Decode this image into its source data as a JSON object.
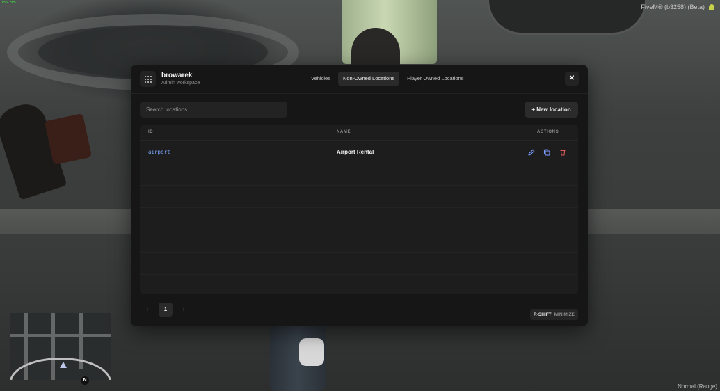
{
  "hud": {
    "fps": "156 FPS",
    "fivem_label": "FiveM® (b3258) (Beta)",
    "mode_label": "Normal (Range)",
    "compass": "N"
  },
  "panel": {
    "icon": "grid-dots-icon",
    "title": "browarek",
    "subtitle": "Admin workspace",
    "tabs": [
      {
        "label": "Vehicles",
        "active": false
      },
      {
        "label": "Non-Owned Locations",
        "active": true
      },
      {
        "label": "Player Owned Locations",
        "active": false
      }
    ],
    "close_icon": "close-icon",
    "close_glyph": "✕"
  },
  "toolbar": {
    "search_placeholder": "Search locations...",
    "new_button_label": "+ New location"
  },
  "table": {
    "columns": [
      "ID",
      "NAME",
      "ACTIONS"
    ],
    "rows": [
      {
        "id": "airport",
        "name": "Airport Rental",
        "actions": [
          "edit-icon",
          "duplicate-icon",
          "delete-icon"
        ]
      }
    ]
  },
  "pagination": {
    "prev_glyph": "‹",
    "current_page": "1",
    "next_glyph": "›"
  },
  "shortcut": {
    "key": "R-SHIFT",
    "label": "MINIMIZE"
  },
  "colors": {
    "accent_id": "#7aa7ff",
    "edit_icon": "#7a9cff",
    "duplicate_icon": "#7a9cff",
    "delete_icon": "#e05a5a",
    "panel_bg": "#161616"
  }
}
